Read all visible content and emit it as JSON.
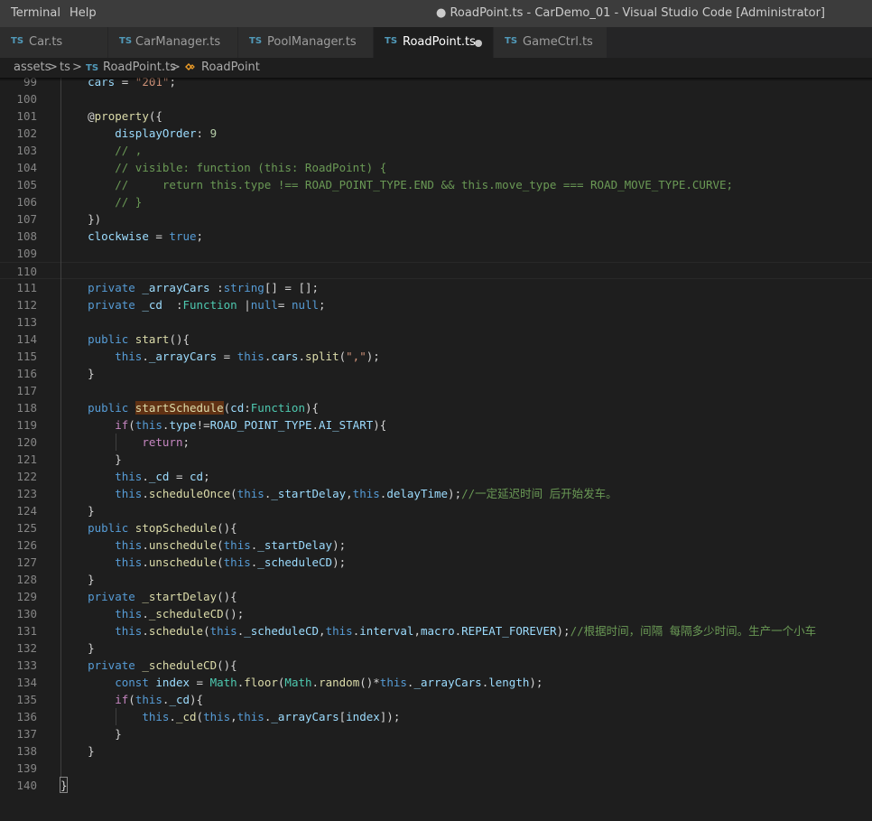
{
  "menu": {
    "terminal": "Terminal",
    "help": "Help"
  },
  "window_title": "● RoadPoint.ts - CarDemo_01 - Visual Studio Code [Administrator]",
  "tabs": [
    {
      "badge": "TS",
      "label": "Car.ts",
      "active": false,
      "dirty": false
    },
    {
      "badge": "TS",
      "label": "CarManager.ts",
      "active": false,
      "dirty": false
    },
    {
      "badge": "TS",
      "label": "PoolManager.ts",
      "active": false,
      "dirty": false
    },
    {
      "badge": "TS",
      "label": "RoadPoint.ts",
      "active": true,
      "dirty": true
    },
    {
      "badge": "TS",
      "label": "GameCtrl.ts",
      "active": false,
      "dirty": false
    }
  ],
  "breadcrumb": {
    "seg1": "assets",
    "seg2": "ts",
    "file_badge": "TS",
    "file": "RoadPoint.ts",
    "symbol": "RoadPoint",
    "sep": ">"
  },
  "lines": [
    {
      "n": "99",
      "t": "    cars = \"201\";"
    },
    {
      "n": "100",
      "t": ""
    },
    {
      "n": "101",
      "t": "    @property({"
    },
    {
      "n": "102",
      "t": "        displayOrder: 9"
    },
    {
      "n": "103",
      "t": "        // ,"
    },
    {
      "n": "104",
      "t": "        // visible: function (this: RoadPoint) {"
    },
    {
      "n": "105",
      "t": "        //     return this.type !== ROAD_POINT_TYPE.END && this.move_type === ROAD_MOVE_TYPE.CURVE;"
    },
    {
      "n": "106",
      "t": "        // }"
    },
    {
      "n": "107",
      "t": "    })"
    },
    {
      "n": "108",
      "t": "    clockwise = true;"
    },
    {
      "n": "109",
      "t": ""
    },
    {
      "n": "110",
      "t": ""
    },
    {
      "n": "111",
      "t": "    private _arrayCars :string[] = [];"
    },
    {
      "n": "112",
      "t": "    private _cd  :Function |null= null;"
    },
    {
      "n": "113",
      "t": ""
    },
    {
      "n": "114",
      "t": "    public start(){"
    },
    {
      "n": "115",
      "t": "        this._arrayCars = this.cars.split(\",\");"
    },
    {
      "n": "116",
      "t": "    }"
    },
    {
      "n": "117",
      "t": ""
    },
    {
      "n": "118",
      "t": "    public startSchedule(cd:Function){"
    },
    {
      "n": "119",
      "t": "        if(this.type!=ROAD_POINT_TYPE.AI_START){"
    },
    {
      "n": "120",
      "t": "            return;"
    },
    {
      "n": "121",
      "t": "        }"
    },
    {
      "n": "122",
      "t": "        this._cd = cd;"
    },
    {
      "n": "123",
      "t": "        this.scheduleOnce(this._startDelay,this.delayTime);//一定延迟时间 后开始发车。"
    },
    {
      "n": "124",
      "t": "    }"
    },
    {
      "n": "125",
      "t": "    public stopSchedule(){"
    },
    {
      "n": "126",
      "t": "        this.unschedule(this._startDelay);"
    },
    {
      "n": "127",
      "t": "        this.unschedule(this._scheduleCD);"
    },
    {
      "n": "128",
      "t": "    }"
    },
    {
      "n": "129",
      "t": "    private _startDelay(){"
    },
    {
      "n": "130",
      "t": "        this._scheduleCD();"
    },
    {
      "n": "131",
      "t": "        this.schedule(this._scheduleCD,this.interval,macro.REPEAT_FOREVER);//根据时间，间隔 每隔多少时间。生产一个小车"
    },
    {
      "n": "132",
      "t": "    }"
    },
    {
      "n": "133",
      "t": "    private _scheduleCD(){"
    },
    {
      "n": "134",
      "t": "        const index = Math.floor(Math.random()*this._arrayCars.length);"
    },
    {
      "n": "135",
      "t": "        if(this._cd){"
    },
    {
      "n": "136",
      "t": "            this._cd(this,this._arrayCars[index]);"
    },
    {
      "n": "137",
      "t": "        }"
    },
    {
      "n": "138",
      "t": "    }"
    },
    {
      "n": "139",
      "t": ""
    },
    {
      "n": "140",
      "t": "}"
    }
  ],
  "current_line": "110",
  "colors": {
    "accent": "#519aba",
    "bg": "#1e1e1e",
    "highlight": "#613214"
  },
  "icons": {
    "file": "ts-file-icon",
    "symbol": "class-symbol-icon",
    "dirty": "unsaved-dot-icon"
  }
}
